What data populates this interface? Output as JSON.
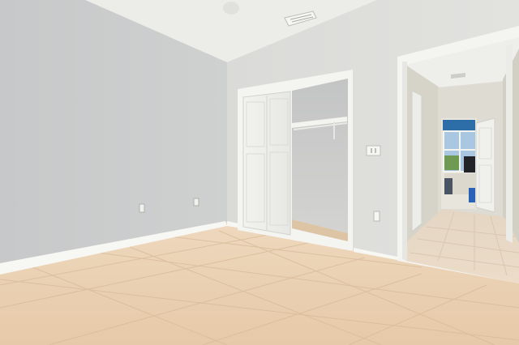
{
  "scene": {
    "kind": "photo",
    "subject": "empty-room-interior",
    "colors": {
      "left_wall": "#c9cacb",
      "right_wall": "#dcdcda",
      "ceiling": "#ecece9",
      "floor_tile": "#e7cdb0",
      "floor_grout": "#d6b995",
      "baseboard": "#f6f6f3",
      "trim": "#f4f4f1",
      "hallway_wall": "#d5d2c8",
      "hallway_floor": "#eadbc8",
      "window_sky": "#a9c7e0",
      "blue_wall": "#2e6ea8"
    },
    "objects": [
      "ceiling-vent",
      "closet-door",
      "closet-shelf",
      "hanging-rod",
      "light-switch",
      "electrical-outlet",
      "doorway",
      "hallway",
      "window",
      "interior-door"
    ]
  }
}
